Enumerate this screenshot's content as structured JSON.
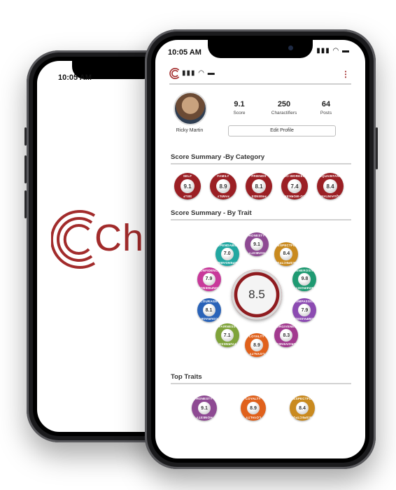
{
  "back_phone": {
    "time": "10:05 AM",
    "splash_text": "Chara"
  },
  "front_phone": {
    "time": "10:05 AM",
    "status_icons": "▮▮▮ ◠ ▬",
    "app_bar": {
      "status_icons": "▮▮▮ ◠ ▬",
      "menu_icon": "⋮"
    },
    "profile": {
      "name": "Ricky Martin",
      "stats": [
        {
          "value": "9.1",
          "label": "Score"
        },
        {
          "value": "250",
          "label": "Charactifiers"
        },
        {
          "value": "64",
          "label": "Posts"
        }
      ],
      "edit_label": "Edit Profile"
    },
    "category_section": {
      "title": "Score Summary -By Category",
      "items": [
        {
          "top": "SELF",
          "score": "9.1",
          "bottom": "SELF"
        },
        {
          "top": "FAMILY",
          "score": "8.9",
          "bottom": "FAMILY"
        },
        {
          "top": "FRIENDS",
          "score": "8.1",
          "bottom": "FRIENDS"
        },
        {
          "top": "CO-WORKER",
          "score": "7.4",
          "bottom": "CO-WORKER"
        },
        {
          "top": "ACQUAINTANCES",
          "score": "8.4",
          "bottom": "ACQUAINTANCES"
        }
      ]
    },
    "trait_section": {
      "title": "Score Summary - By Trait",
      "overall": "8.5",
      "traits": [
        {
          "name": "HONESTY",
          "score": "9.1",
          "color": "#8e4a93"
        },
        {
          "name": "RESPECTFUL",
          "score": "8.4",
          "color": "#c98a1f"
        },
        {
          "name": "GENEROSITY",
          "score": "9.8",
          "color": "#1f9a72"
        },
        {
          "name": "COMPASSION",
          "score": "7.9",
          "color": "#8c4bb2"
        },
        {
          "name": "FORGIVENESS",
          "score": "8.3",
          "color": "#a23a8f"
        },
        {
          "name": "LOYALTY",
          "score": "8.9",
          "color": "#e0611c"
        },
        {
          "name": "FAIRNESS",
          "score": "7.1",
          "color": "#7fa33a"
        },
        {
          "name": "COURAGE",
          "score": "8.1",
          "color": "#2a63b8"
        },
        {
          "name": "CONFIDENCE",
          "score": "7.9",
          "color": "#c8399a"
        },
        {
          "name": "DEPENDABILITY",
          "score": "7.0",
          "color": "#22a7a1"
        }
      ]
    },
    "top_traits": {
      "title": "Top Traits",
      "items": [
        {
          "name": "HONESTY",
          "score": "9.1",
          "color": "#8e4a93"
        },
        {
          "name": "LOYALTY",
          "score": "8.9",
          "color": "#e0611c"
        },
        {
          "name": "RESPECTFUL",
          "score": "8.4",
          "color": "#c98a1f"
        }
      ]
    },
    "colors": {
      "brand": "#a22b2b",
      "category_ring": "#9b1f24"
    }
  }
}
